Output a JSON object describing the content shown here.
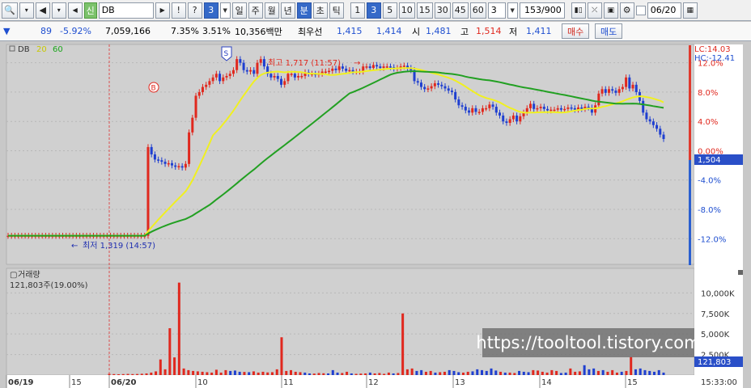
{
  "toolbar": {
    "market_badge": "신",
    "symbol": "DB",
    "exclaim": "!",
    "question": "?",
    "period_count": "3",
    "periods": [
      "일",
      "주",
      "월",
      "년",
      "분",
      "초",
      "틱"
    ],
    "active_period": "분",
    "intervals": [
      "1",
      "3",
      "5",
      "10",
      "15",
      "30",
      "45",
      "60"
    ],
    "active_interval": "3",
    "custom_interval": "3",
    "bar_count": "153/900",
    "date": "06/20"
  },
  "info": {
    "price": "89",
    "change_pct": "-5.92%",
    "volume": "7,059,166",
    "vol_pct": "7.35%",
    "turnover": "3.51%",
    "amount": "10,356백만",
    "best_bid_label": "최우선",
    "ask": "1,415",
    "bid": "1,414",
    "open_label": "시",
    "open": "1,481",
    "high_label": "고",
    "high": "1,514",
    "low_label": "저",
    "low": "1,411",
    "buy_label": "매수",
    "sell_label": "매도"
  },
  "chart_data": {
    "type": "candlestick",
    "symbol": "DB",
    "legend": [
      {
        "name": "DB",
        "color": "#000000"
      },
      {
        "name": "20",
        "color": "#e6e600"
      },
      {
        "name": "60",
        "color": "#1aa61a"
      }
    ],
    "annotations": {
      "high_label": "최고 1,717 (11:57)",
      "low_label": "최저 1,319 (14:57)",
      "lc": "LC:14.03",
      "hc": "HC:-12.41",
      "buy_marker": "B",
      "sell_marker": "S"
    },
    "price_axis": [
      "12.0%",
      "8.0%",
      "4.0%",
      "0.00%",
      "-4.0%",
      "-8.0%",
      "-12.0%"
    ],
    "current_price": "1,504",
    "volume_title": "거래량",
    "volume_info": "121,803주(19.00%)",
    "volume_axis": [
      "10,000K",
      "7,500K",
      "5,000K",
      "2,500K"
    ],
    "current_volume": "121,803",
    "x_labels": [
      "06/19",
      "15",
      "06/20",
      "10",
      "11",
      "12",
      "13",
      "14",
      "15"
    ],
    "time_label": "15:33:00",
    "price_pct": [
      -11.6,
      -11.6,
      -11.6,
      -11.6,
      -11.6,
      -11.6,
      -11.6,
      -11.6,
      -11.6,
      -11.6,
      -11.6,
      -11.6,
      -11.6,
      -11.6,
      -11.6,
      -11.6,
      -11.6,
      -11.6,
      -11.6,
      -11.6,
      -11.6,
      -11.6,
      -11.6,
      -11.6,
      -11.6,
      -11.6,
      -11.6,
      -11.6,
      -11.6,
      -11.6,
      -11.6,
      -11.6,
      -11.6,
      -11.6,
      -11.6,
      -11.6,
      -11.6,
      -11.6,
      -11.6,
      -11.6,
      -11.6,
      0.5,
      -0.5,
      -1.2,
      -1.3,
      -1.5,
      -1.8,
      -1.7,
      -2.0,
      -2.2,
      -2.1,
      -2.3,
      -1.8,
      2.5,
      4.5,
      7.5,
      8.0,
      8.7,
      9.0,
      9.5,
      10.0,
      10.5,
      9.5,
      10.0,
      10.2,
      10.5,
      11.0,
      12.5,
      12.0,
      11.0,
      10.8,
      11.0,
      10.5,
      12.0,
      12.5,
      11.5,
      10.5,
      10.0,
      10.2,
      9.8,
      9.0,
      9.5,
      10.5,
      10.5,
      10.0,
      10.2,
      10.2,
      10.7,
      10.5,
      10.5,
      10.4,
      10.5,
      10.8,
      10.8,
      10.9,
      11.2,
      11.0,
      11.5,
      11.2,
      10.9,
      11.0,
      10.8,
      10.8,
      10.8,
      11.5,
      11.5,
      11.3,
      11.7,
      11.5,
      11.3,
      11.5,
      11.5,
      11.4,
      11.2,
      11.3,
      11.5,
      11.6,
      11.3,
      11.0,
      9.5,
      9.3,
      8.7,
      8.4,
      8.5,
      8.8,
      9.2,
      9.0,
      8.8,
      8.5,
      8.2,
      8.0,
      7.0,
      6.2,
      6.0,
      5.5,
      5.2,
      5.8,
      5.3,
      5.3,
      5.8,
      5.8,
      6.3,
      6.0,
      5.2,
      4.8,
      4.0,
      3.8,
      4.3,
      4.8,
      4.0,
      4.7,
      5.2,
      5.8,
      6.4,
      5.7,
      5.8,
      6.0,
      5.7,
      5.5,
      5.6,
      5.6,
      5.8,
      5.6,
      5.7,
      5.9,
      5.8,
      5.6,
      5.9,
      5.7,
      6.0,
      5.9,
      5.2,
      6.2,
      7.8,
      8.4,
      7.9,
      8.4,
      8.2,
      7.9,
      8.4,
      8.7,
      10.0,
      8.5,
      9.0,
      8.0,
      6.8,
      5.2,
      4.3,
      4.0,
      3.5,
      3.0,
      2.2,
      1.6
    ],
    "price_axis_values": [
      12,
      8,
      4,
      0,
      -4,
      -8,
      -12
    ],
    "volume_k": [
      150,
      120,
      100,
      120,
      140,
      120,
      130,
      160,
      200,
      300,
      450,
      1900,
      700,
      5700,
      2150,
      11250,
      800,
      600,
      500,
      450,
      400,
      350,
      300,
      650,
      300,
      600,
      500,
      550,
      400,
      380,
      350,
      450,
      300,
      400,
      320,
      350,
      700,
      4600,
      500,
      600,
      400,
      350,
      300,
      200,
      180,
      250,
      220,
      200,
      600,
      300,
      250,
      400,
      200,
      150,
      180,
      200,
      300,
      200,
      250,
      150,
      300,
      200,
      250,
      7500,
      700,
      800,
      500,
      600,
      400,
      500,
      300,
      350,
      400,
      600,
      500,
      350,
      300,
      400,
      450,
      700,
      600,
      500,
      800,
      550,
      400,
      300,
      300,
      250,
      500,
      400,
      350,
      600,
      550,
      400,
      300,
      600,
      500,
      250,
      300,
      800,
      400,
      450,
      1200,
      700,
      800,
      500,
      600,
      400,
      600,
      300,
      400,
      500,
      2200,
      700,
      800,
      600,
      500,
      400,
      600,
      300
    ]
  },
  "watermark": "https://tooltool.tistory.com"
}
